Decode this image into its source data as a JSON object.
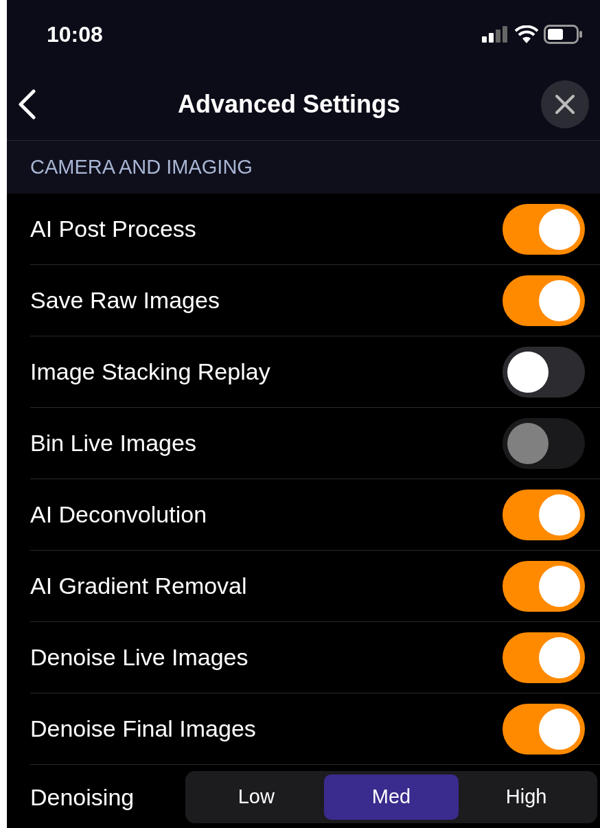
{
  "status_bar": {
    "time": "10:08"
  },
  "nav": {
    "title": "Advanced Settings"
  },
  "section": {
    "header": "CAMERA AND IMAGING"
  },
  "settings": [
    {
      "label": "AI Post Process",
      "on": true,
      "disabled": false
    },
    {
      "label": "Save Raw Images",
      "on": true,
      "disabled": false
    },
    {
      "label": "Image Stacking Replay",
      "on": false,
      "disabled": false
    },
    {
      "label": "Bin Live Images",
      "on": false,
      "disabled": true
    },
    {
      "label": "AI Deconvolution",
      "on": true,
      "disabled": false
    },
    {
      "label": "AI Gradient Removal",
      "on": true,
      "disabled": false
    },
    {
      "label": "Denoise Live Images",
      "on": true,
      "disabled": false
    },
    {
      "label": "Denoise Final Images",
      "on": true,
      "disabled": false
    }
  ],
  "denoising": {
    "label": "Denoising",
    "options": [
      {
        "label": "Low",
        "selected": false
      },
      {
        "label": "Med",
        "selected": true
      },
      {
        "label": "High",
        "selected": false
      }
    ]
  }
}
